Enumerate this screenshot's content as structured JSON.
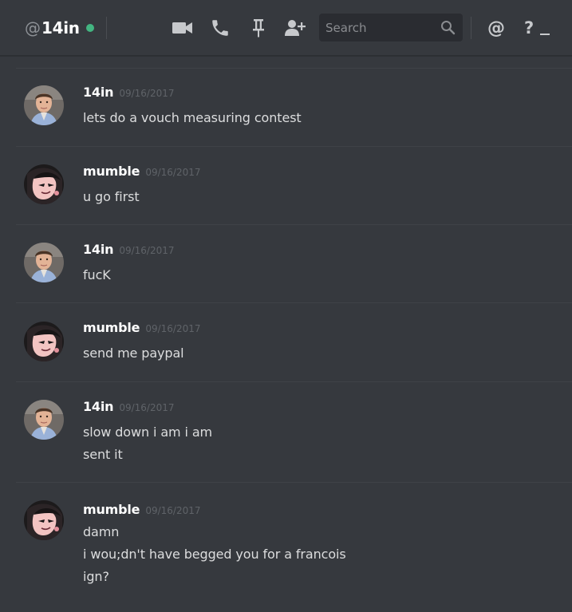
{
  "header": {
    "at_sign": "@",
    "channel_name": "14in",
    "status": "online",
    "status_color": "#43b581",
    "icons": [
      "video-call-icon",
      "voice-call-icon",
      "pin-icon",
      "add-friend-icon"
    ],
    "search": {
      "placeholder": "Search",
      "value": ""
    },
    "mentions_label": "@",
    "help_label": "?"
  },
  "messages": [
    {
      "author": "14in",
      "avatar": "office-man-avatar",
      "timestamp": "09/16/2017",
      "lines": [
        "lets do a vouch measuring contest"
      ]
    },
    {
      "author": "mumble",
      "avatar": "anime-girl-avatar",
      "timestamp": "09/16/2017",
      "lines": [
        "u go first"
      ]
    },
    {
      "author": "14in",
      "avatar": "office-man-avatar",
      "timestamp": "09/16/2017",
      "lines": [
        "fucK"
      ]
    },
    {
      "author": "mumble",
      "avatar": "anime-girl-avatar",
      "timestamp": "09/16/2017",
      "lines": [
        "send me paypal"
      ]
    },
    {
      "author": "14in",
      "avatar": "office-man-avatar",
      "timestamp": "09/16/2017",
      "lines": [
        "slow down i am i am",
        "sent it"
      ]
    },
    {
      "author": "mumble",
      "avatar": "anime-girl-avatar",
      "timestamp": "09/16/2017",
      "lines": [
        "damn",
        "i wou;dn't have begged you for a francois",
        "ign?"
      ]
    }
  ],
  "colors": {
    "background": "#36393e",
    "search_background": "#2a2c31",
    "divider": "#3f4247",
    "username": "#ffffff",
    "message_text": "#dcddde",
    "timestamp": "#5f6368"
  }
}
